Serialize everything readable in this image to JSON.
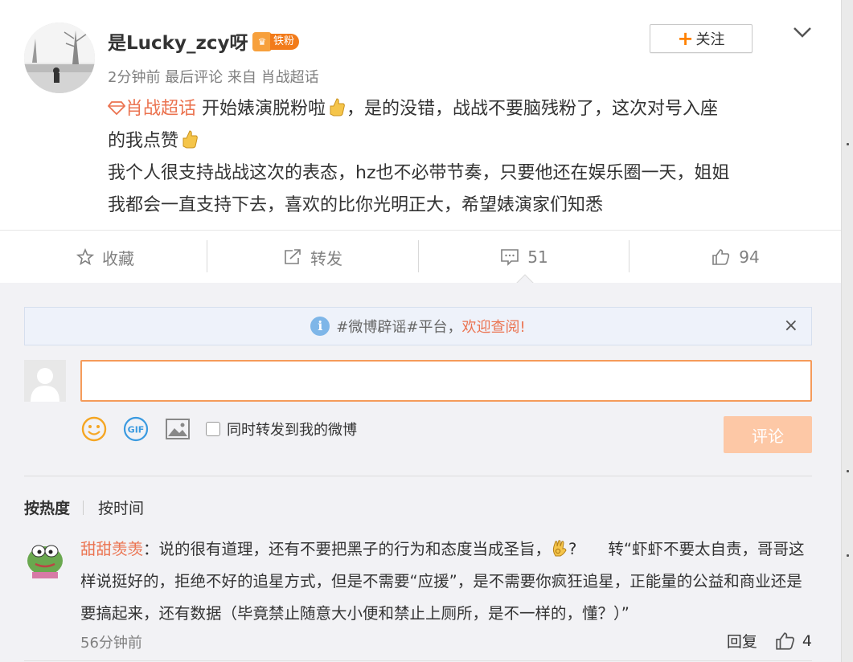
{
  "post": {
    "username": "是Lucky_zcy呀",
    "fan_badge": "铁粉",
    "meta": "2分钟前 最后评论 来自 肖战超话",
    "follow_label": "关注",
    "super_topic": "肖战超话",
    "line1_a": " 开始婊演脱粉啦",
    "line1_b": "，是的没错，战战不要脑残粉了，这次对号入座",
    "line2": "的我点赞",
    "line3": "我个人很支持战战这次的表态，hz也不必带节奏，只要他还在娱乐圈一天，姐姐",
    "line4": "我都会一直支持下去，喜欢的比你光明正大，希望婊演家们知悉"
  },
  "actions": {
    "favorite_label": "收藏",
    "repost_label": "转发",
    "comment_count": "51",
    "like_count": "94"
  },
  "notice": {
    "text": "#微博辟谣#平台，",
    "link": "欢迎查阅!",
    "close": "×"
  },
  "composer": {
    "input_value": "",
    "repost_checkbox_label": "同时转发到我的微博",
    "submit_label": "评论"
  },
  "sort": {
    "active": "按热度",
    "other": "按时间"
  },
  "comments": [
    {
      "user": "甜甜羡羡",
      "text_a": "：说的很有道理，还有不要把黑子的行为和态度当成圣旨，",
      "text_b": "?　　转“虾虾不要太自责，哥哥这样说挺好的，拒绝不好的追星方式，但是不需要“应援”，是不需要你疯狂追星，正能量的公益和商业还是要搞起来，还有数据（毕竟禁止随意大小便和禁止上厕所，是不一样的，懂？）”",
      "time": "56分钟前",
      "reply_label": "回复",
      "likes": "4"
    }
  ],
  "colors": {
    "accent": "#eb7350",
    "orange": "#ff8200",
    "input_border": "#f59b5a",
    "submit_disabled": "#fdc8a6"
  }
}
